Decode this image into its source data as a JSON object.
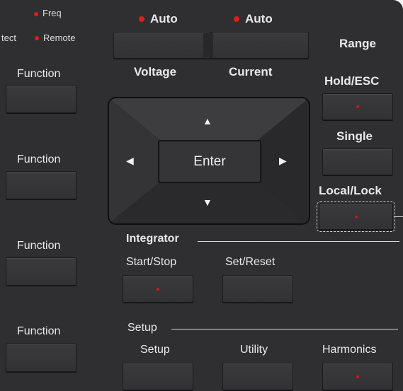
{
  "indicators": {
    "freq": "Freq",
    "protect_partial": "tect",
    "remote": "Remote"
  },
  "top": {
    "voltage_auto": "Auto",
    "current_auto": "Auto",
    "voltage": "Voltage",
    "current": "Current",
    "range": "Range"
  },
  "left": {
    "function_1": "Function",
    "function_2": "Function",
    "function_3": "Function",
    "function_4": "Function"
  },
  "right": {
    "hold_esc": "Hold/ESC",
    "single": "Single",
    "local_lock": "Local/Lock"
  },
  "dpad": {
    "enter": "Enter",
    "up": "▲",
    "down": "▼",
    "left": "◀",
    "right": "▶"
  },
  "integrator": {
    "title": "Integrator",
    "start_stop": "Start/Stop",
    "set_reset": "Set/Reset"
  },
  "setup": {
    "title": "Setup",
    "setup": "Setup",
    "utility": "Utility",
    "harmonics": "Harmonics"
  },
  "colors": {
    "panel": "#2f2f31",
    "led": "#e01b1b"
  }
}
